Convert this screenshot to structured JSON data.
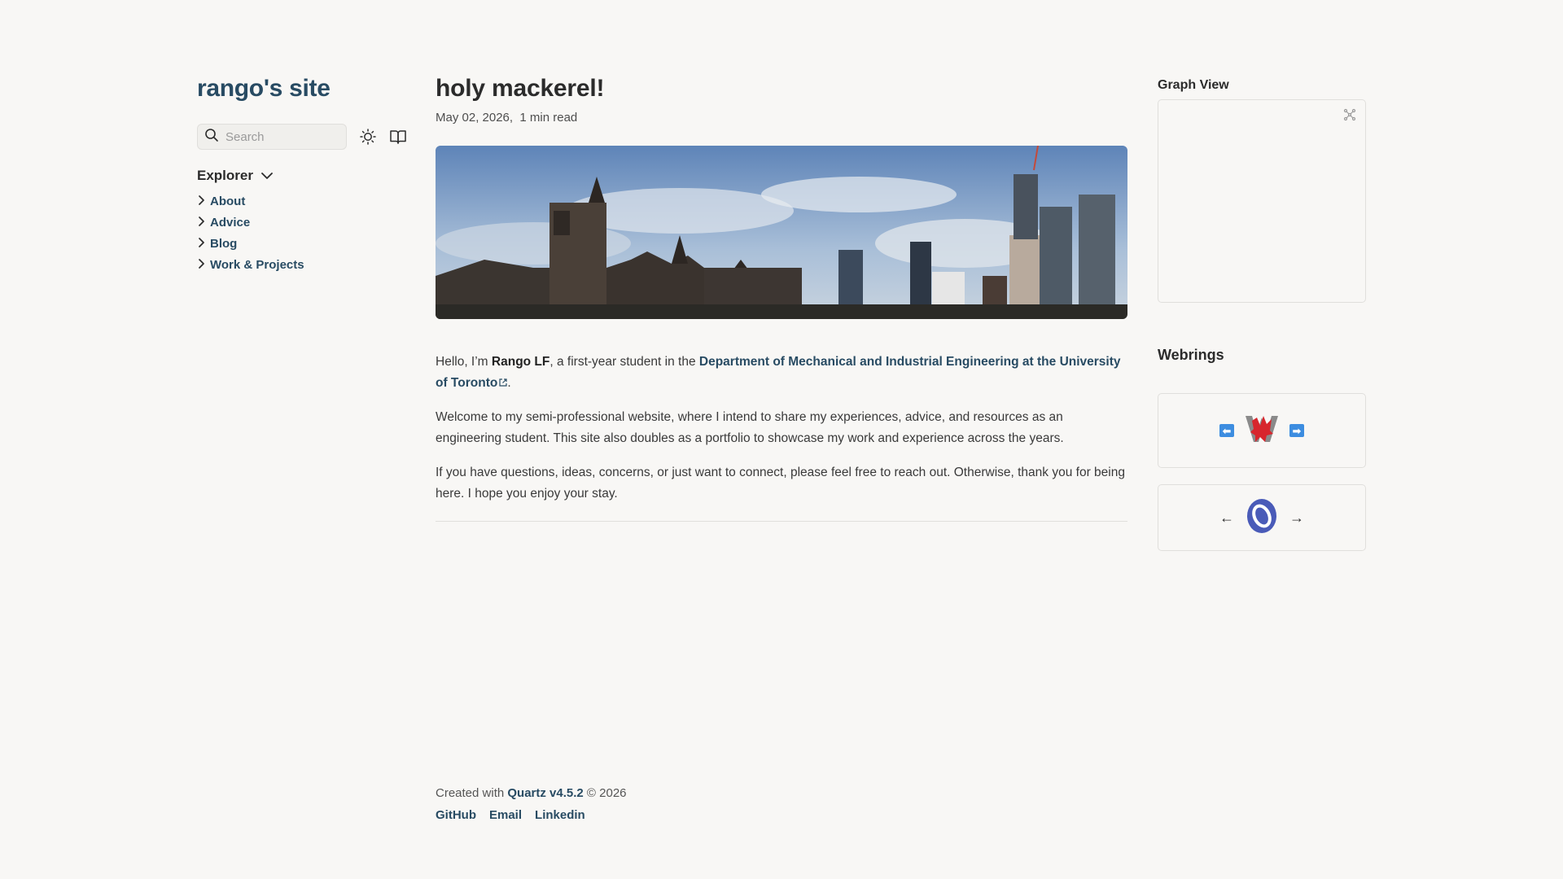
{
  "sidebar": {
    "site_title": "rango's site",
    "search_placeholder": "Search",
    "explorer_label": "Explorer",
    "items": [
      {
        "label": "About"
      },
      {
        "label": "Advice"
      },
      {
        "label": "Blog"
      },
      {
        "label": "Work & Projects"
      }
    ]
  },
  "post": {
    "title": "holy mackerel!",
    "date": "May 02, 2026,",
    "read_time": "1 min read",
    "p1_a": "Hello, I’m ",
    "p1_name": "Rango LF",
    "p1_b": ", a first-year student in the ",
    "p1_link": "Department of Mechanical and Industrial Engineering at the University of Toronto",
    "p1_c": ".",
    "p2": "Welcome to my semi-professional website, where I intend to share my experiences, advice, and resources as an engineering student. This site also doubles as a portfolio to showcase my work and experience across the years.",
    "p3": "If you have questions, ideas, concerns, or just want to connect, please feel free to reach out. Otherwise, thank you for being here. I hope you enjoy your stay."
  },
  "footer": {
    "created_prefix": "Created with ",
    "quartz": "Quartz v4.5.2",
    "year": " © 2026",
    "links": [
      {
        "label": "GitHub"
      },
      {
        "label": "Email"
      },
      {
        "label": "Linkedin"
      }
    ]
  },
  "right": {
    "graph_title": "Graph View",
    "webrings_title": "Webrings",
    "ring2_prev": "←",
    "ring2_next": "→"
  },
  "colors": {
    "accent": "#284b63",
    "background": "#f8f7f5",
    "border": "#e0dfdc"
  }
}
